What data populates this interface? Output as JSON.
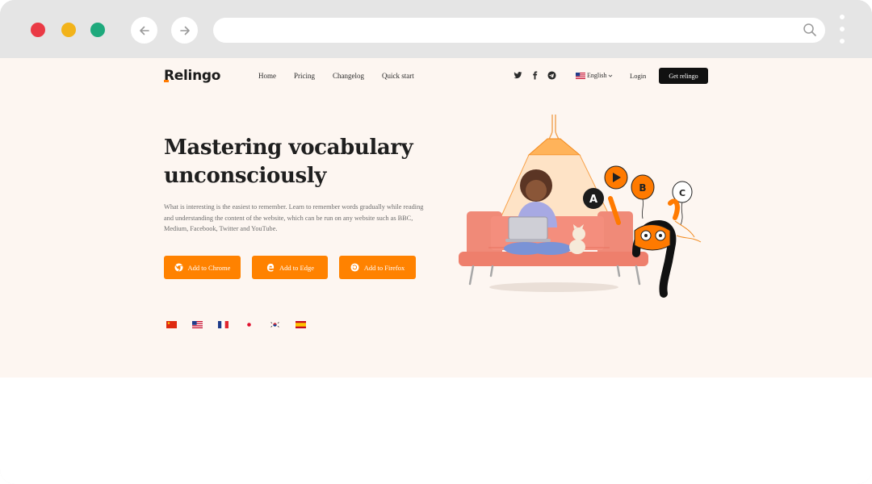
{
  "browser": {
    "controls": [
      "close",
      "minimize",
      "maximize"
    ],
    "nav": [
      "back-icon",
      "forward-icon"
    ],
    "url": "",
    "menu_icon": "more-vertical-icon"
  },
  "header": {
    "logo": "Relingo",
    "menu": [
      "Home",
      "Pricing",
      "Changelog",
      "Quick start"
    ],
    "socials": [
      "twitter-icon",
      "facebook-icon",
      "telegram-icon"
    ],
    "language": "English",
    "login": "Login",
    "cta": "Get relingo"
  },
  "hero": {
    "title_line1": "Mastering vocabulary",
    "title_line2": "unconsciously",
    "description": "What is interesting is the easiest to remember. Learn to remember words gradually while reading and understanding the content of the website, which can be run on any website such as BBC, Medium, Facebook, Twitter and YouTube.",
    "buttons": [
      "Add to Chrome",
      "Add to Edge",
      "Add to Firefox"
    ],
    "flags": [
      "china-flag",
      "usa-flag",
      "france-flag",
      "japan-flag",
      "korea-flag",
      "spain-flag"
    ]
  },
  "illustration": {
    "balloon_letters": [
      "A",
      "B",
      "C"
    ]
  },
  "colors": {
    "accent": "#ff8200",
    "page_bg": "#fdf6f1",
    "chrome_bg": "#e5e5e5",
    "dark": "#111111"
  }
}
